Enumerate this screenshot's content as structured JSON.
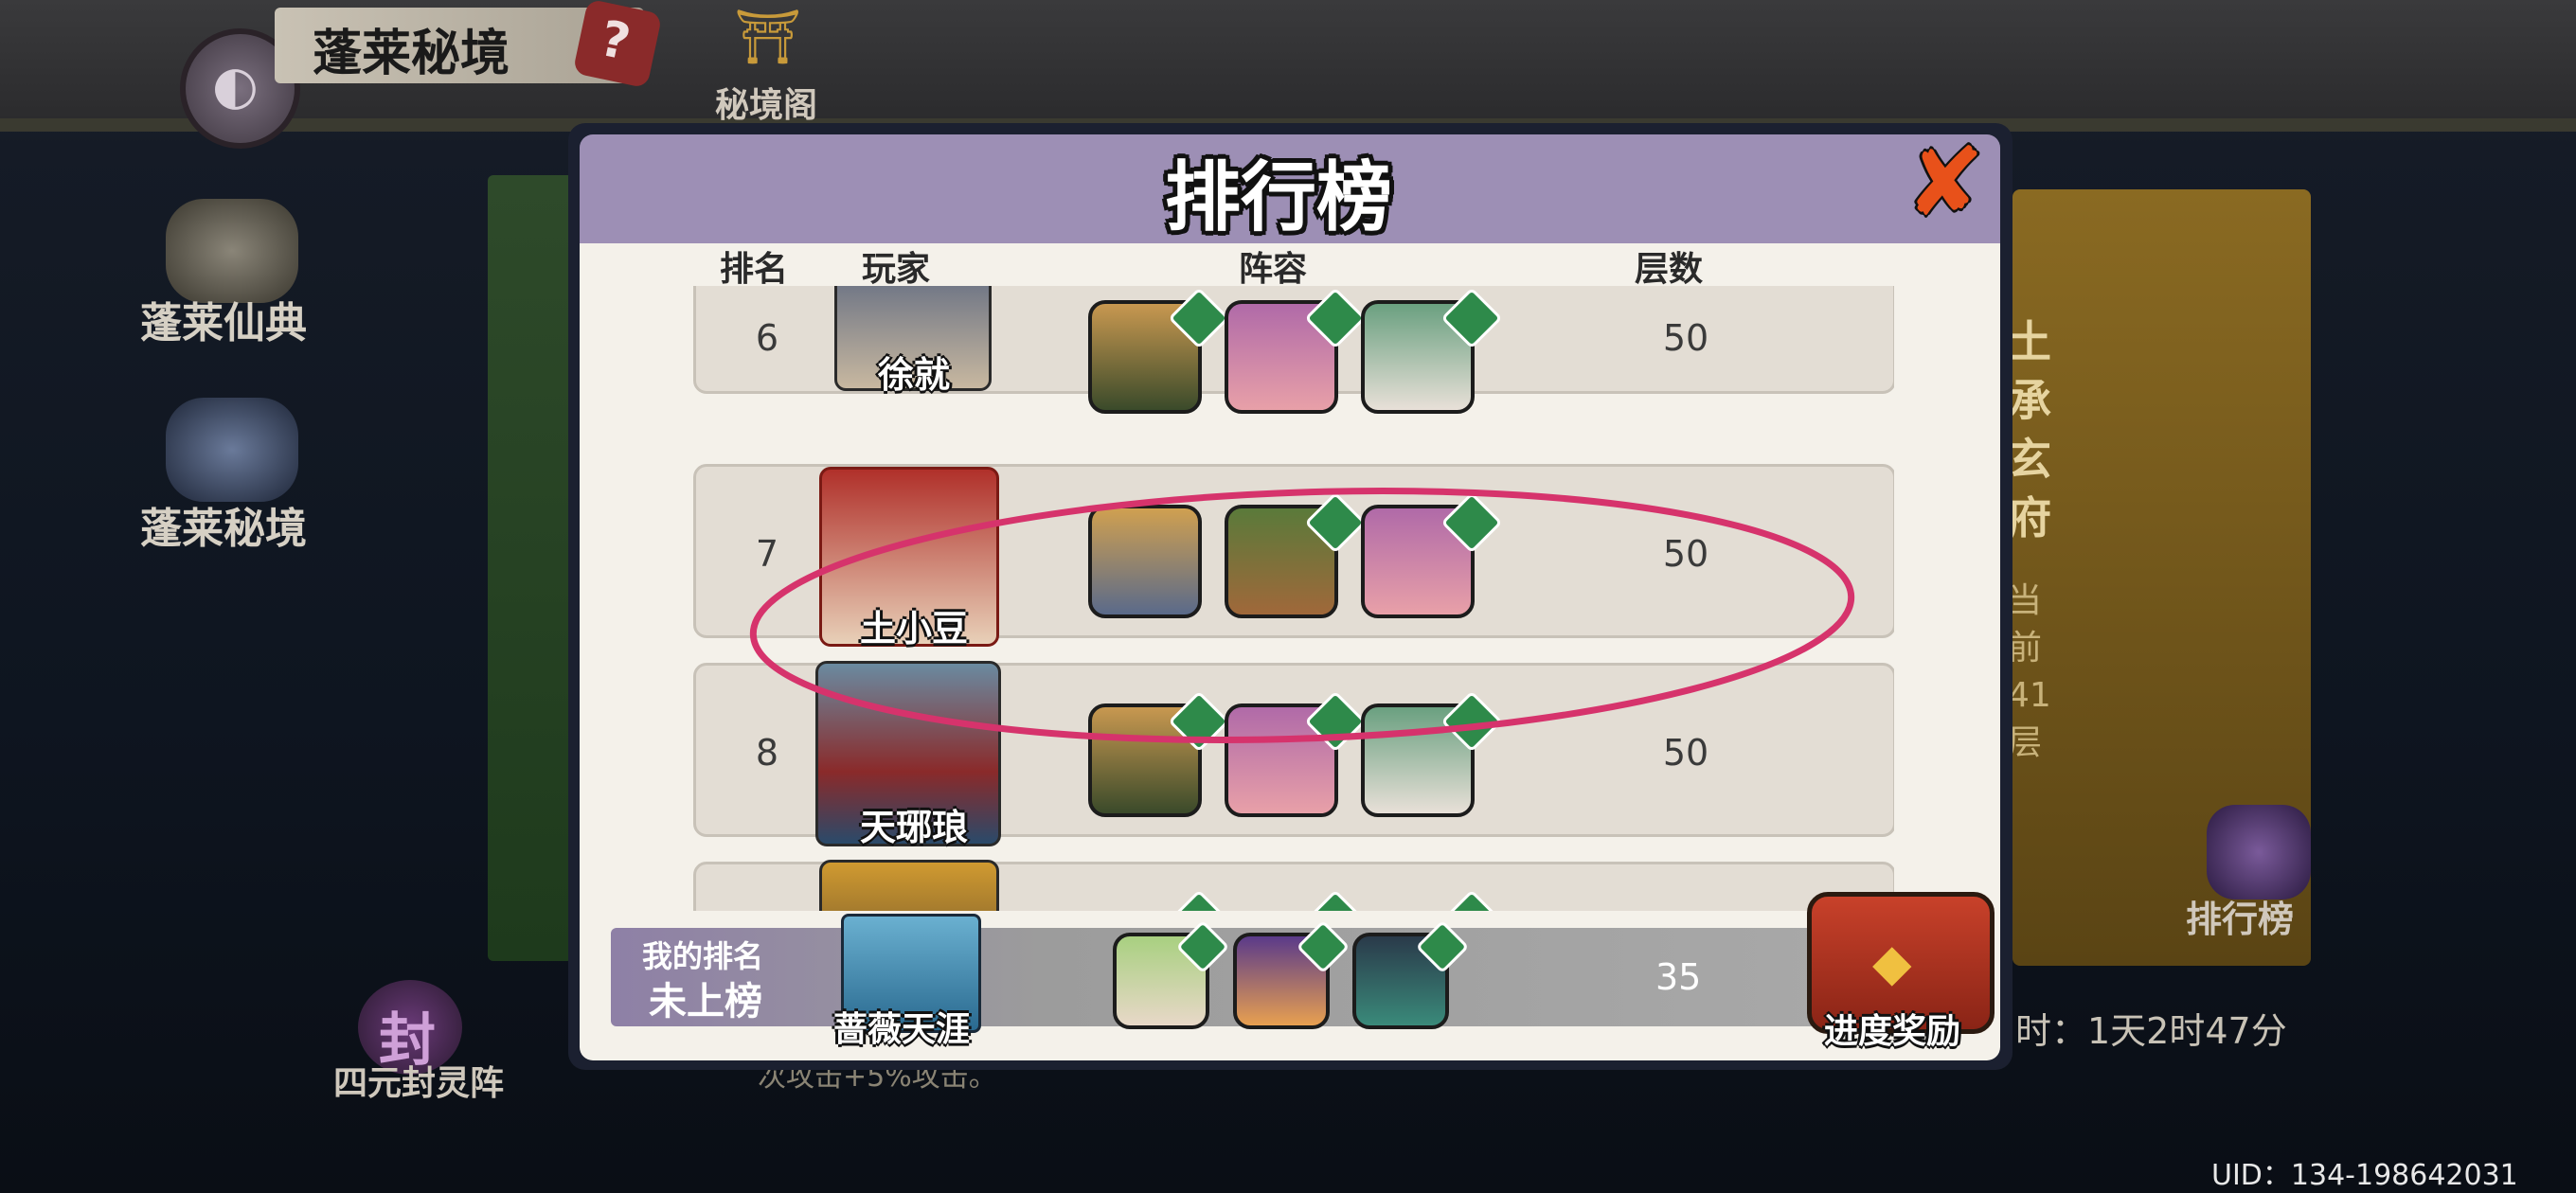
{
  "header": {
    "title": "蓬莱秘境",
    "back_icon": "back-icon",
    "help_icon": "?",
    "mijing_label": "秘境阁"
  },
  "side_menu": {
    "items": [
      {
        "label": "蓬莱仙典"
      },
      {
        "label": "蓬莱秘境"
      },
      {
        "label": "四元封灵阵",
        "icon_glyph": "封"
      }
    ]
  },
  "right_panel": {
    "book_title": "土承玄府",
    "progress": "当前41层",
    "ranking_label": "排行榜",
    "timer": "时：1天2时47分",
    "uid": "UID：134-198642031"
  },
  "bottom_tip": "次攻击+5%攻击。",
  "dialog": {
    "title": "排行榜",
    "close_icon": "close-icon",
    "columns": {
      "rank": "排名",
      "player": "玩家",
      "lineup": "阵容",
      "floors": "层数"
    },
    "rows": [
      {
        "rank": "6",
        "player": "徐就",
        "score": "50"
      },
      {
        "rank": "7",
        "player": "土小豆",
        "score": "50"
      },
      {
        "rank": "8",
        "player": "天琊琅",
        "score": "50"
      },
      {
        "rank": "",
        "player": "",
        "score": ""
      }
    ],
    "my_rank": {
      "label": "我的排名",
      "status": "未上榜",
      "player": "蔷薇天涯",
      "score": "35"
    },
    "reward_label": "进度奖励",
    "colors": {
      "header": "#9d8fb5",
      "body": "#f4f1ea",
      "row": "#e3ddd4",
      "highlight": "#d6336c",
      "close": "#e8511a"
    }
  }
}
